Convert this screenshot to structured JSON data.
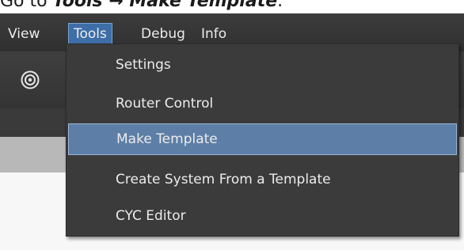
{
  "caption": {
    "prefix": "Go to ",
    "emphasis": "Tools → Make Template",
    "suffix": "."
  },
  "menubar": {
    "items": [
      {
        "label": "View"
      },
      {
        "label": "Tools"
      },
      {
        "label": "Debug"
      },
      {
        "label": "Info"
      }
    ],
    "active": "Tools"
  },
  "toolbar": {
    "icon": "target-icon"
  },
  "tools_menu": {
    "items": [
      {
        "label": "Settings"
      },
      {
        "label": "Router Control"
      },
      {
        "label": "Make Template"
      },
      {
        "label": "Create System From a Template"
      },
      {
        "label": "CYC Editor"
      }
    ],
    "highlighted": "Make Template"
  },
  "colors": {
    "menubar": "#333333",
    "menu_active": "#3d6ea8",
    "item_highlight": "#5d7ea6",
    "dropdown_bg": "#3b3b3b"
  }
}
